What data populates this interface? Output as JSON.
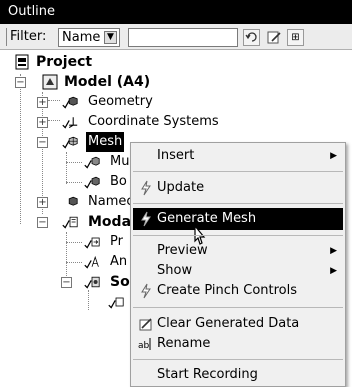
{
  "panel": {
    "title": "Outline"
  },
  "filter": {
    "label": "Filter:",
    "selected": "Name",
    "search_value": ""
  },
  "tree": {
    "project": "Project",
    "model": "Model (A4)",
    "geometry": "Geometry",
    "coordinate_systems": "Coordinate Systems",
    "mesh": "Mesh",
    "mesh_child_1": "Mu",
    "mesh_child_2": "Bo",
    "named_selections": "Namec",
    "modal": "Modal",
    "modal_child_1": "Pr",
    "modal_child_2": "An",
    "solution": "So"
  },
  "context_menu": {
    "items": [
      {
        "label": "Insert",
        "submenu": true,
        "icon": ""
      },
      {
        "label": "Update",
        "submenu": false,
        "icon": "lightning-icon"
      },
      {
        "label": "Generate Mesh",
        "submenu": false,
        "icon": "lightning-icon",
        "highlighted": true
      },
      {
        "label": "Preview",
        "submenu": true,
        "icon": ""
      },
      {
        "label": "Show",
        "submenu": true,
        "icon": ""
      },
      {
        "label": "Create Pinch Controls",
        "submenu": false,
        "icon": "lightning-icon"
      },
      {
        "label": "Clear Generated Data",
        "submenu": false,
        "icon": "clear-data-icon"
      },
      {
        "label": "Rename",
        "submenu": false,
        "icon": "rename-icon"
      },
      {
        "label": "Start Recording",
        "submenu": false,
        "icon": ""
      }
    ]
  },
  "colors": {
    "title_bg": "#000000",
    "highlight_bg": "#000000",
    "menu_bg": "#f0f0f0"
  }
}
